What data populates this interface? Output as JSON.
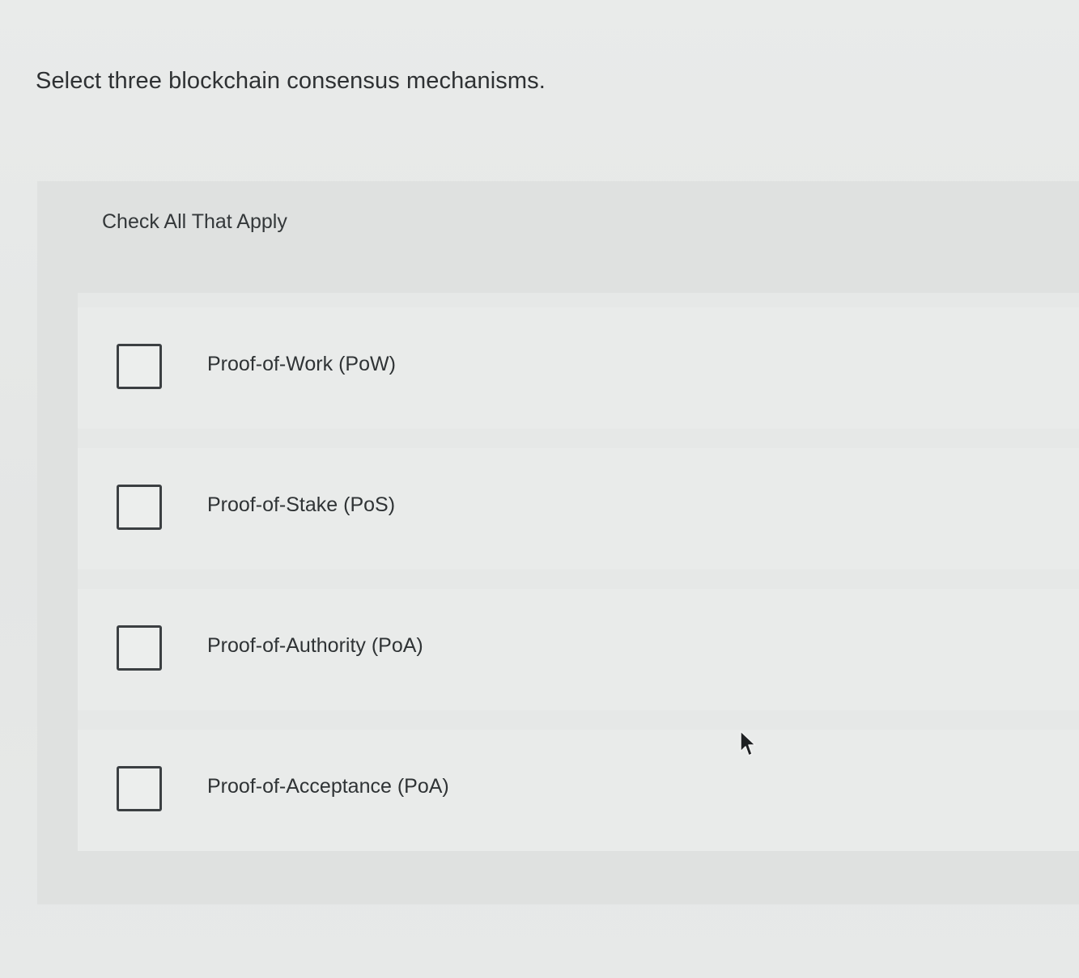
{
  "question": {
    "text": "Select three blockchain consensus mechanisms."
  },
  "panel": {
    "instruction": "Check All That Apply",
    "options": [
      {
        "label": "Proof-of-Work (PoW)",
        "checked": false
      },
      {
        "label": "Proof-of-Stake (PoS)",
        "checked": false
      },
      {
        "label": "Proof-of-Authority (PoA)",
        "checked": false
      },
      {
        "label": "Proof-of-Acceptance (PoA)",
        "checked": false
      }
    ]
  },
  "cursor": {
    "icon": "mouse-pointer-icon"
  }
}
